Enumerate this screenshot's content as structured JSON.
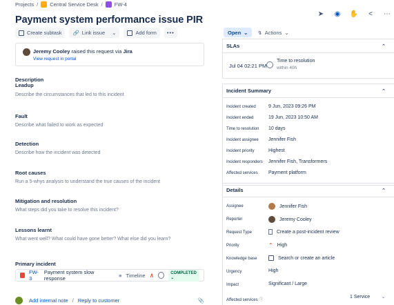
{
  "breadcrumb": {
    "projects": "Projects",
    "sep": "/",
    "project": "Central Service Desk",
    "issue_key": "FW-4"
  },
  "title": "Payment system performance issue PIR",
  "toolbar": {
    "create_subtask": "Create subtask",
    "link_issue": "Link issue",
    "add_form": "Add form",
    "more": "•••"
  },
  "raised_by": {
    "name": "Jeremy Cooley",
    "text_mid": " raised this request via ",
    "channel": "Jira",
    "link": "View request in portal"
  },
  "fields": [
    {
      "heading": "Description",
      "sub": "Leadup",
      "desc": "Describe the circumstances that led to this incident"
    },
    {
      "heading": "Fault",
      "desc": "Describe what failed to work as expected"
    },
    {
      "heading": "Detection",
      "desc": "Describe how the incident was detected"
    },
    {
      "heading": "Root causes",
      "desc": "Run a 5-whys analysis to understand the true causes of the incident"
    },
    {
      "heading": "Mitigation and resolution",
      "desc": "What steps did you take to resolve this incident?"
    },
    {
      "heading": "Lessons learnt",
      "desc": "What went well? What could have gone better? What else did you learn?"
    }
  ],
  "primary_incident": {
    "heading": "Primary incident",
    "key": "FW-3",
    "summary": "Payment system slow response",
    "timeline": "Timeline",
    "status": "COMPLETED"
  },
  "comment": {
    "internal": "Add internal note",
    "sep": "/",
    "reply": "Reply to customer"
  },
  "status": {
    "label": "Open",
    "actions": "Actions"
  },
  "slas": {
    "title": "SLAs",
    "date": "Jul 04 02:21 PM",
    "name": "Time to resolution",
    "goal": "within 40h"
  },
  "incident_summary": {
    "title": "Incident Summary",
    "rows": [
      {
        "k": "Incident created",
        "v": "9 Jun, 2023 09:26 PM"
      },
      {
        "k": "Incident ended",
        "v": "19 Jun, 2023 10:50 AM"
      },
      {
        "k": "Time to resolution",
        "v": "10 days"
      },
      {
        "k": "Incident assignee",
        "v": "Jennifer Fish"
      },
      {
        "k": "Incident priority",
        "v": "Highest"
      },
      {
        "k": "Incident responders",
        "v": "Jennifer Fish, Transformers"
      },
      {
        "k": "Affected services",
        "v": "Payment platform"
      }
    ]
  },
  "details": {
    "title": "Details",
    "assignee": {
      "k": "Assignee",
      "v": "Jennifer Fish"
    },
    "reporter": {
      "k": "Reporter",
      "v": "Jeremy Cooley"
    },
    "request_type": {
      "k": "Request Type",
      "v": "Create a post-incident review"
    },
    "priority": {
      "k": "Priority",
      "v": "High"
    },
    "knowledge_base": {
      "k": "Knowledge base",
      "v": "Search or create an article"
    },
    "urgency": {
      "k": "Urgency",
      "v": "High"
    },
    "impact": {
      "k": "Impact",
      "v": "Significant / Large"
    },
    "affected_services": {
      "k": "Affected services",
      "v": "1 Service"
    }
  },
  "colors": {
    "accent": "#0052cc",
    "status_bg": "#deebff",
    "completed_bg": "#e3fcef",
    "priority": "#de350b"
  },
  "icons": [
    "announcement-icon",
    "eye-icon",
    "thumbs-up-icon",
    "share-icon",
    "more-icon",
    "chevron-up-icon",
    "clock-icon",
    "attachment-icon"
  ]
}
